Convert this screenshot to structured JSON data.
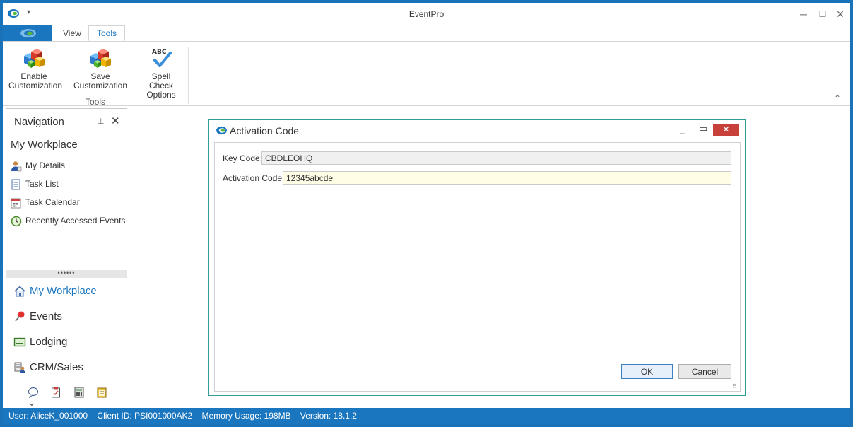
{
  "window": {
    "title": "EventPro",
    "minimize_glyph": "─",
    "maximize_glyph": "☐",
    "close_glyph": "✕",
    "quick_access_glyph": "▾"
  },
  "ribbon": {
    "tabs": [
      {
        "label": "View",
        "active": false
      },
      {
        "label": "Tools",
        "active": true
      }
    ],
    "buttons": [
      {
        "line1": "Enable",
        "line2": "Customization",
        "icon": "cubes-icon"
      },
      {
        "line1": "Save Customization",
        "line2": "",
        "icon": "cubes-icon"
      },
      {
        "line1": "Spell Check",
        "line2": "Options",
        "icon": "abc-check-icon"
      }
    ],
    "spell_icon_text": "ABC",
    "group_label": "Tools",
    "collapse_glyph": "⌃"
  },
  "navigation": {
    "title": "Navigation",
    "pin_glyph": "⊥",
    "close_glyph": "✕",
    "section": "My Workplace",
    "items": [
      {
        "label": "My Details",
        "icon": "user-icon"
      },
      {
        "label": "Task List",
        "icon": "task-list-icon"
      },
      {
        "label": "Task Calendar",
        "icon": "calendar-icon"
      },
      {
        "label": "Recently Accessed Events",
        "icon": "clock-icon"
      }
    ],
    "splitter_glyph": "••••••",
    "modules": [
      {
        "label": "My Workplace",
        "icon": "home-icon",
        "selected": true
      },
      {
        "label": "Events",
        "icon": "pin-icon",
        "selected": false
      },
      {
        "label": "Lodging",
        "icon": "lodging-icon",
        "selected": false
      },
      {
        "label": "CRM/Sales",
        "icon": "crm-icon",
        "selected": false
      }
    ],
    "more_glyph": "⌄"
  },
  "dialog": {
    "title": "Activation Code",
    "min_glyph": "_",
    "max_glyph": "▭",
    "close_glyph": "✕",
    "key_code_label": "Key Code:",
    "key_code_value": "CBDLEOHQ",
    "activation_label": "Activation Code:",
    "activation_value": "12345abcde",
    "ok_label": "OK",
    "cancel_label": "Cancel",
    "grip_glyph": "⠿"
  },
  "status_bar": {
    "user": "User: AliceK_001000",
    "client_id": "Client ID: PSI001000AK2",
    "memory": "Memory Usage: 198MB",
    "version": "Version: 18.1.2"
  },
  "colors": {
    "accent": "#1b76c0",
    "dialog_border": "#2e9e96",
    "close_red": "#c8403a"
  }
}
